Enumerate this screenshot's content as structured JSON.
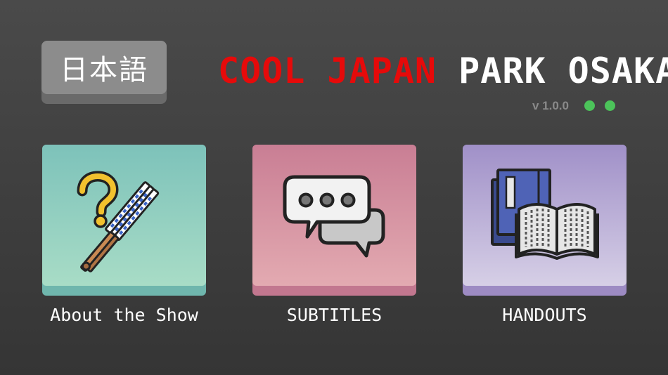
{
  "language_button": {
    "label": "日本語"
  },
  "header": {
    "title_red": "COOL JAPAN",
    "title_white": "PARK OSAKA",
    "version": "v 1.0.0",
    "status_color": "#4cc35a"
  },
  "menu": {
    "items": [
      {
        "label": "About the Show",
        "icon": "question-fan-icon",
        "color": "#7dc2ba"
      },
      {
        "label": "SUBTITLES",
        "icon": "chat-bubbles-icon",
        "color": "#c97e94"
      },
      {
        "label": "HANDOUTS",
        "icon": "books-icon",
        "color": "#a090c8"
      }
    ]
  }
}
